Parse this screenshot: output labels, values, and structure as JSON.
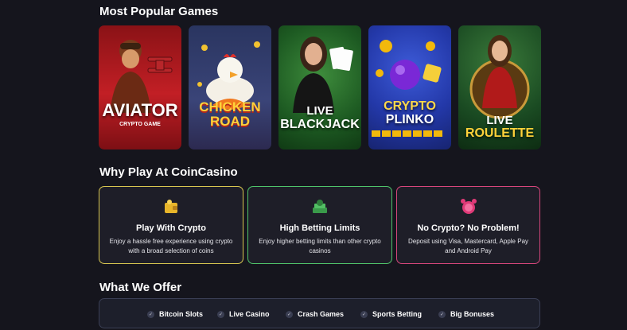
{
  "sections": {
    "popular_title": "Most Popular Games",
    "why_title": "Why Play At CoinCasino",
    "offer_title": "What We Offer"
  },
  "games": [
    {
      "title": "AVIATOR",
      "subtitle": "CRYPTO GAME"
    },
    {
      "title_line1": "CHICKEN",
      "title_line2": "ROAD"
    },
    {
      "title_line1": "LIVE",
      "title_line2": "BLACKJACK"
    },
    {
      "title_line1": "CRYPTO",
      "title_line2": "PLINKO"
    },
    {
      "title_line1": "LIVE",
      "title_line2": "ROULETTE"
    }
  ],
  "reasons": [
    {
      "title": "Play With Crypto",
      "description": "Enjoy a hassle free experience using crypto with a broad selection of coins",
      "icon": "wallet-icon"
    },
    {
      "title": "High Betting Limits",
      "description": "Enjoy higher betting limits than other crypto casinos",
      "icon": "money-stack-icon"
    },
    {
      "title": "No Crypto? No Problem!",
      "description": "Deposit using Visa, Mastercard, Apple Pay and Android Pay",
      "icon": "alarm-clock-icon"
    }
  ],
  "offers": [
    "Bitcoin Slots",
    "Live Casino",
    "Crash Games",
    "Sports Betting",
    "Big Bonuses"
  ],
  "colors": {
    "background": "#15151d",
    "card_border_yellow": "#d8c650",
    "card_border_green": "#4fc46a",
    "card_border_pink": "#d8467c"
  }
}
